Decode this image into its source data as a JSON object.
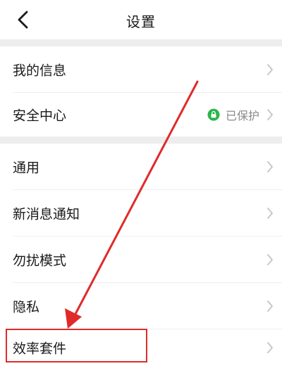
{
  "header": {
    "title": "设置",
    "back_icon": "chevron-left-icon"
  },
  "groups": [
    {
      "items": [
        {
          "label": "我的信息"
        },
        {
          "label": "安全中心",
          "status": {
            "text": "已保护",
            "icon": "lock-shield-icon",
            "color": "#2bb54c"
          }
        }
      ]
    },
    {
      "items": [
        {
          "label": "通用"
        },
        {
          "label": "新消息通知"
        },
        {
          "label": "勿扰模式"
        },
        {
          "label": "隐私"
        },
        {
          "label": "效率套件"
        }
      ]
    }
  ],
  "annotation": {
    "highlighted_item": "效率套件",
    "color": "#e02a2a"
  },
  "colors": {
    "section_gap": "#ededed",
    "chevron": "#c4c4c4",
    "status_text": "#8a8a8a"
  }
}
